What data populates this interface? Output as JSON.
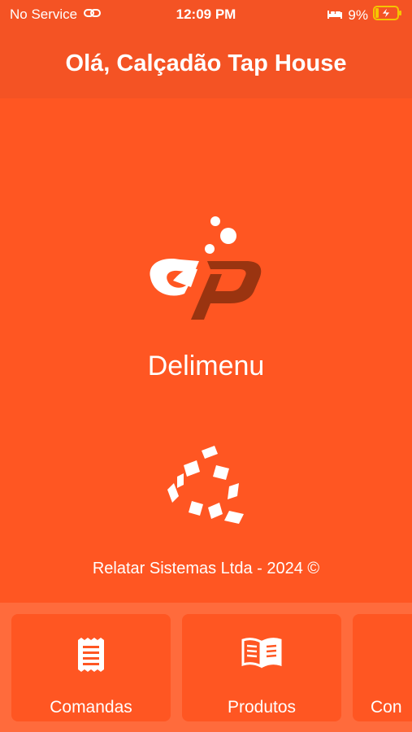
{
  "status_bar": {
    "carrier": "No Service",
    "time": "12:09 PM",
    "battery": "9%"
  },
  "header": {
    "title": "Olá, Calçadão Tap House"
  },
  "main": {
    "app_name": "Delimenu",
    "copyright": "Relatar Sistemas Ltda - 2024 ©"
  },
  "bottom_nav": {
    "items": [
      {
        "label": "Comandas",
        "icon": "receipt-icon"
      },
      {
        "label": "Produtos",
        "icon": "open-book-icon"
      },
      {
        "label": "Con",
        "icon": ""
      }
    ]
  },
  "colors": {
    "primary": "#FF5622",
    "header": "#F45324",
    "bottom_bar": "#FF6B3C",
    "logo_dark": "#9A3410"
  }
}
